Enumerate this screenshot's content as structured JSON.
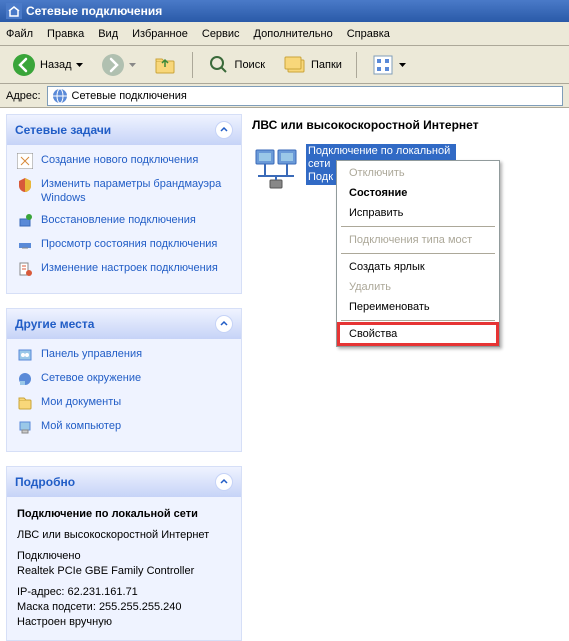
{
  "window": {
    "title": "Сетевые подключения"
  },
  "menubar": [
    "Файл",
    "Правка",
    "Вид",
    "Избранное",
    "Сервис",
    "Дополнительно",
    "Справка"
  ],
  "toolbar": {
    "back": "Назад",
    "search": "Поиск",
    "folders": "Папки"
  },
  "addressbar": {
    "label": "Адрес:",
    "value": "Сетевые подключения"
  },
  "panels": {
    "tasks": {
      "title": "Сетевые задачи",
      "items": [
        "Создание нового подключения",
        "Изменить параметры брандмауэра Windows",
        "Восстановление подключения",
        "Просмотр состояния подключения",
        "Изменение настроек подключения"
      ]
    },
    "places": {
      "title": "Другие места",
      "items": [
        "Панель управления",
        "Сетевое окружение",
        "Мои документы",
        "Мой компьютер"
      ]
    },
    "details": {
      "title": "Подробно",
      "name": "Подключение по локальной сети",
      "type": "ЛВС или высокоскоростной Интернет",
      "status": "Подключено",
      "adapter": "Realtek PCIe GBE Family Controller",
      "ip_label": "IP-адрес:",
      "ip": "62.231.161.71",
      "mask_label": "Маска подсети:",
      "mask": "255.255.255.240",
      "mode": "Настроен вручную"
    }
  },
  "main": {
    "section": "ЛВС или высокоскоростной Интернет",
    "connection": {
      "line1": "Подключение по локальной",
      "line2": "сети",
      "line3": "Подк"
    }
  },
  "context_menu": {
    "items": [
      {
        "label": "Отключить",
        "disabled": true
      },
      {
        "label": "Состояние",
        "bold": true
      },
      {
        "label": "Исправить"
      },
      {
        "sep": true
      },
      {
        "label": "Подключения типа мост",
        "disabled": true
      },
      {
        "sep": true
      },
      {
        "label": "Создать ярлык"
      },
      {
        "label": "Удалить",
        "disabled": true
      },
      {
        "label": "Переименовать"
      },
      {
        "sep": true
      },
      {
        "label": "Свойства",
        "highlighted": true
      }
    ]
  }
}
